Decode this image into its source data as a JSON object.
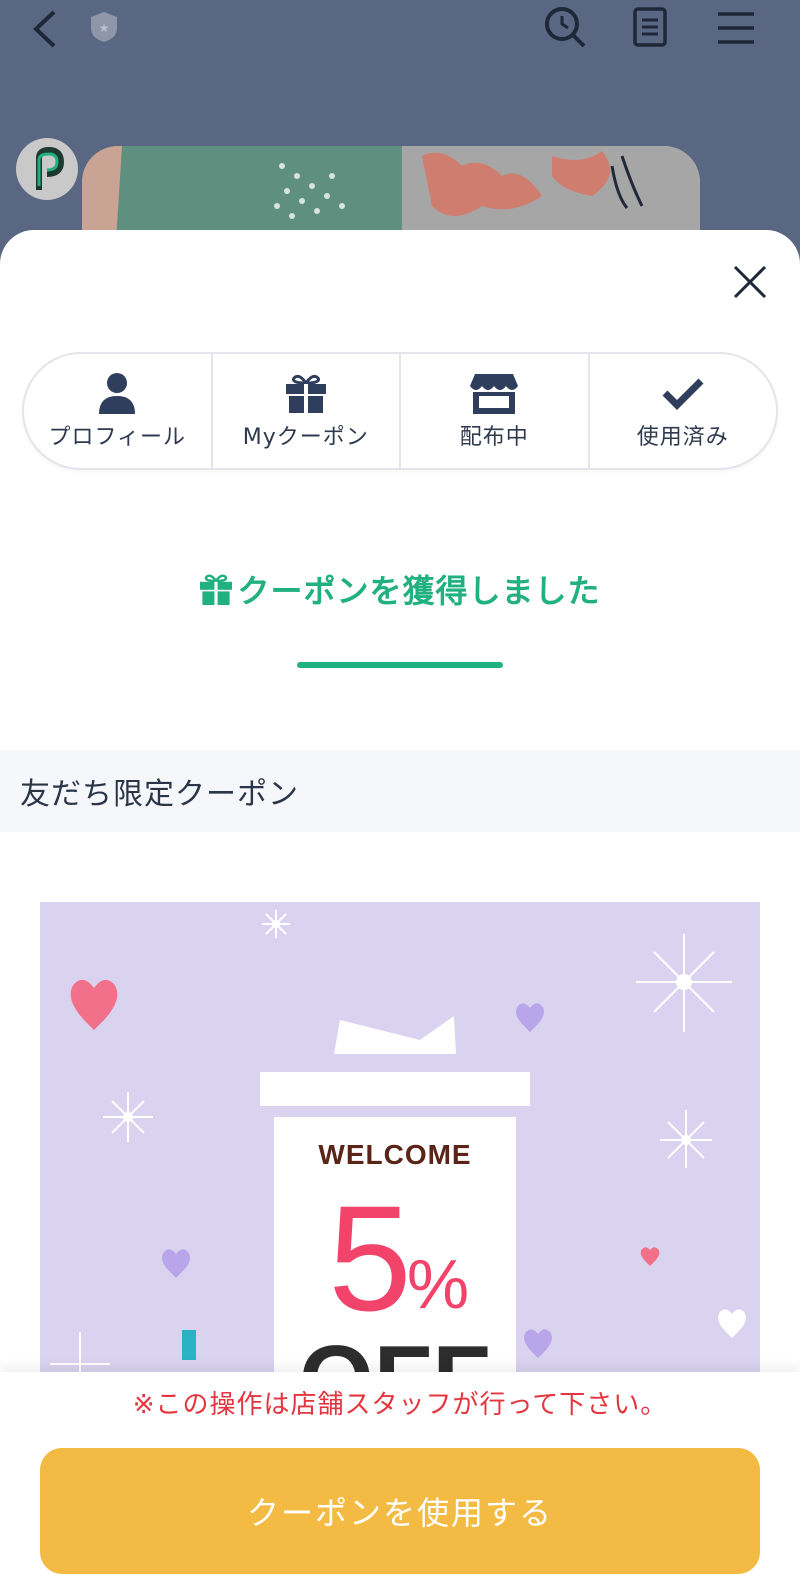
{
  "nav": {
    "back_icon": "back-arrow-icon",
    "badge_icon": "shield-star-icon",
    "search_icon": "search-icon",
    "notes_icon": "notes-icon",
    "menu_icon": "menu-icon"
  },
  "sheet": {
    "close_icon": "close-icon",
    "tabs": [
      {
        "label": "プロフィール",
        "icon": "person-icon"
      },
      {
        "label": "Myクーポン",
        "icon": "gift-icon"
      },
      {
        "label": "配布中",
        "icon": "store-icon"
      },
      {
        "label": "使用済み",
        "icon": "check-icon"
      }
    ],
    "acquired_title": "クーポンを獲得しました",
    "section_title": "友だち限定クーポン",
    "coupon": {
      "headline": "WELCOME",
      "discount": "5%",
      "suffix": "OFF"
    }
  },
  "bottom": {
    "notice": "※この操作は店舗スタッフが行って下さい。",
    "use_button": "クーポンを使用する"
  },
  "colors": {
    "header_bg": "#5a6782",
    "accent_green": "#21b07f",
    "button_yellow": "#f4bb44",
    "notice_red": "#e4363f",
    "coupon_bg": "#d9d3ef",
    "discount_pink": "#f2436a"
  }
}
